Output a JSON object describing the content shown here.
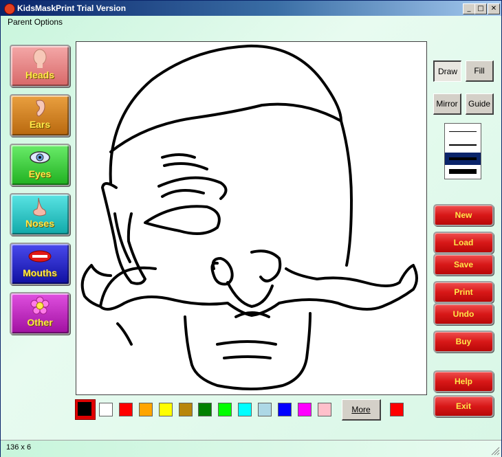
{
  "window": {
    "title": "KidsMaskPrint Trial Version",
    "minimize_glyph": "_",
    "maximize_glyph": "□",
    "close_glyph": "✕"
  },
  "menu": {
    "parent_options": "Parent Options"
  },
  "categories": [
    {
      "label": "Heads",
      "color": "#e88a8a",
      "icon": "head-icon"
    },
    {
      "label": "Ears",
      "color": "#d8862a",
      "icon": "ear-icon"
    },
    {
      "label": "Eyes",
      "color": "#3ad23a",
      "icon": "eye-icon"
    },
    {
      "label": "Noses",
      "color": "#2ac8c8",
      "icon": "nose-icon"
    },
    {
      "label": "Mouths",
      "color": "#2222c8",
      "icon": "mouth-icon"
    },
    {
      "label": "Other",
      "color": "#c020c0",
      "icon": "flower-icon"
    }
  ],
  "palette": {
    "selected": "#000000",
    "colors": [
      "#ffffff",
      "#ff0000",
      "#ffa500",
      "#ffff00",
      "#b8860b",
      "#008000",
      "#00ff00",
      "#00ffff",
      "#add8e6",
      "#0000ff",
      "#ff00ff",
      "#ffc0cb"
    ],
    "more_label": "More",
    "current_color": "#ff0000"
  },
  "tools": {
    "draw": "Draw",
    "fill": "Fill",
    "mirror": "Mirror",
    "guide": "Guide"
  },
  "actions": {
    "new": "New",
    "load": "Load",
    "save": "Save",
    "print": "Print",
    "undo": "Undo",
    "buy": "Buy",
    "help": "Help",
    "exit": "Exit"
  },
  "status": {
    "text": "136 x 6"
  }
}
